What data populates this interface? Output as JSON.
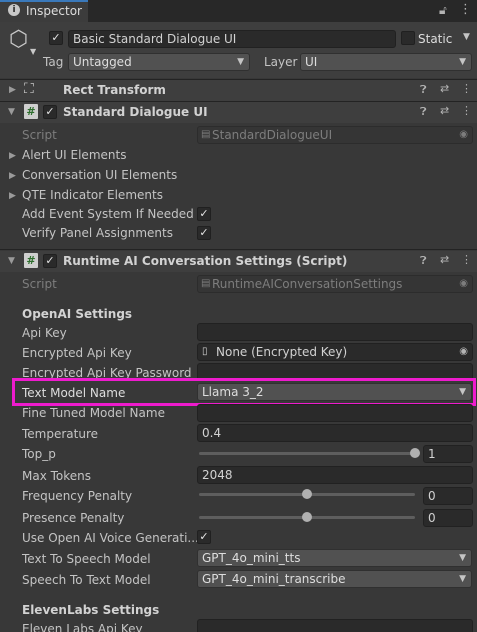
{
  "tab": {
    "title": "Inspector"
  },
  "object": {
    "active": "✓",
    "name": "Basic Standard Dialogue UI",
    "static_label": "Static",
    "tag_label": "Tag",
    "tag_value": "Untagged",
    "layer_label": "Layer",
    "layer_value": "UI"
  },
  "components": {
    "rect_transform": {
      "title": "Rect Transform"
    },
    "standard_dialogue": {
      "title": "Standard Dialogue UI",
      "enabled": "✓",
      "script_label": "Script",
      "script_value": "StandardDialogueUI",
      "foldouts": [
        "Alert UI Elements",
        "Conversation UI Elements",
        "QTE Indicator Elements"
      ],
      "add_event_label": "Add Event System If Needed",
      "add_event_check": "✓",
      "verify_label": "Verify Panel Assignments",
      "verify_check": "✓"
    },
    "runtime_ai": {
      "title": "Runtime AI Conversation Settings (Script)",
      "enabled": "✓",
      "script_label": "Script",
      "script_value": "RuntimeAIConversationSettings",
      "openai_header": "OpenAI Settings",
      "api_key_label": "Api Key",
      "api_key_value": "",
      "encrypted_label": "Encrypted Api Key",
      "encrypted_value": "None (Encrypted Key)",
      "encrypted_pw_label": "Encrypted Api Key Password",
      "text_model_label": "Text Model Name",
      "text_model_value": "Llama 3_2",
      "fine_tuned_label": "Fine Tuned Model Name",
      "temperature_label": "Temperature",
      "temperature_value": "0.4",
      "top_p_label": "Top_p",
      "top_p_value": "1",
      "max_tokens_label": "Max Tokens",
      "max_tokens_value": "2048",
      "freq_label": "Frequency Penalty",
      "freq_value": "0",
      "presence_label": "Presence Penalty",
      "presence_value": "0",
      "voice_label": "Use Open AI Voice Generati...",
      "voice_check": "✓",
      "tts_label": "Text To Speech Model",
      "tts_value": "GPT_4o_mini_tts",
      "stt_label": "Speech To Text Model",
      "stt_value": "GPT_4o_mini_transcribe",
      "eleven_header": "ElevenLabs Settings",
      "eleven_key_label": "Eleven Labs Api Key"
    }
  },
  "sliders": {
    "top_p": 1.0,
    "frequency": 0.5,
    "presence": 0.5
  },
  "colors": {
    "highlight": "#ee1bcd",
    "background": "#383838"
  }
}
